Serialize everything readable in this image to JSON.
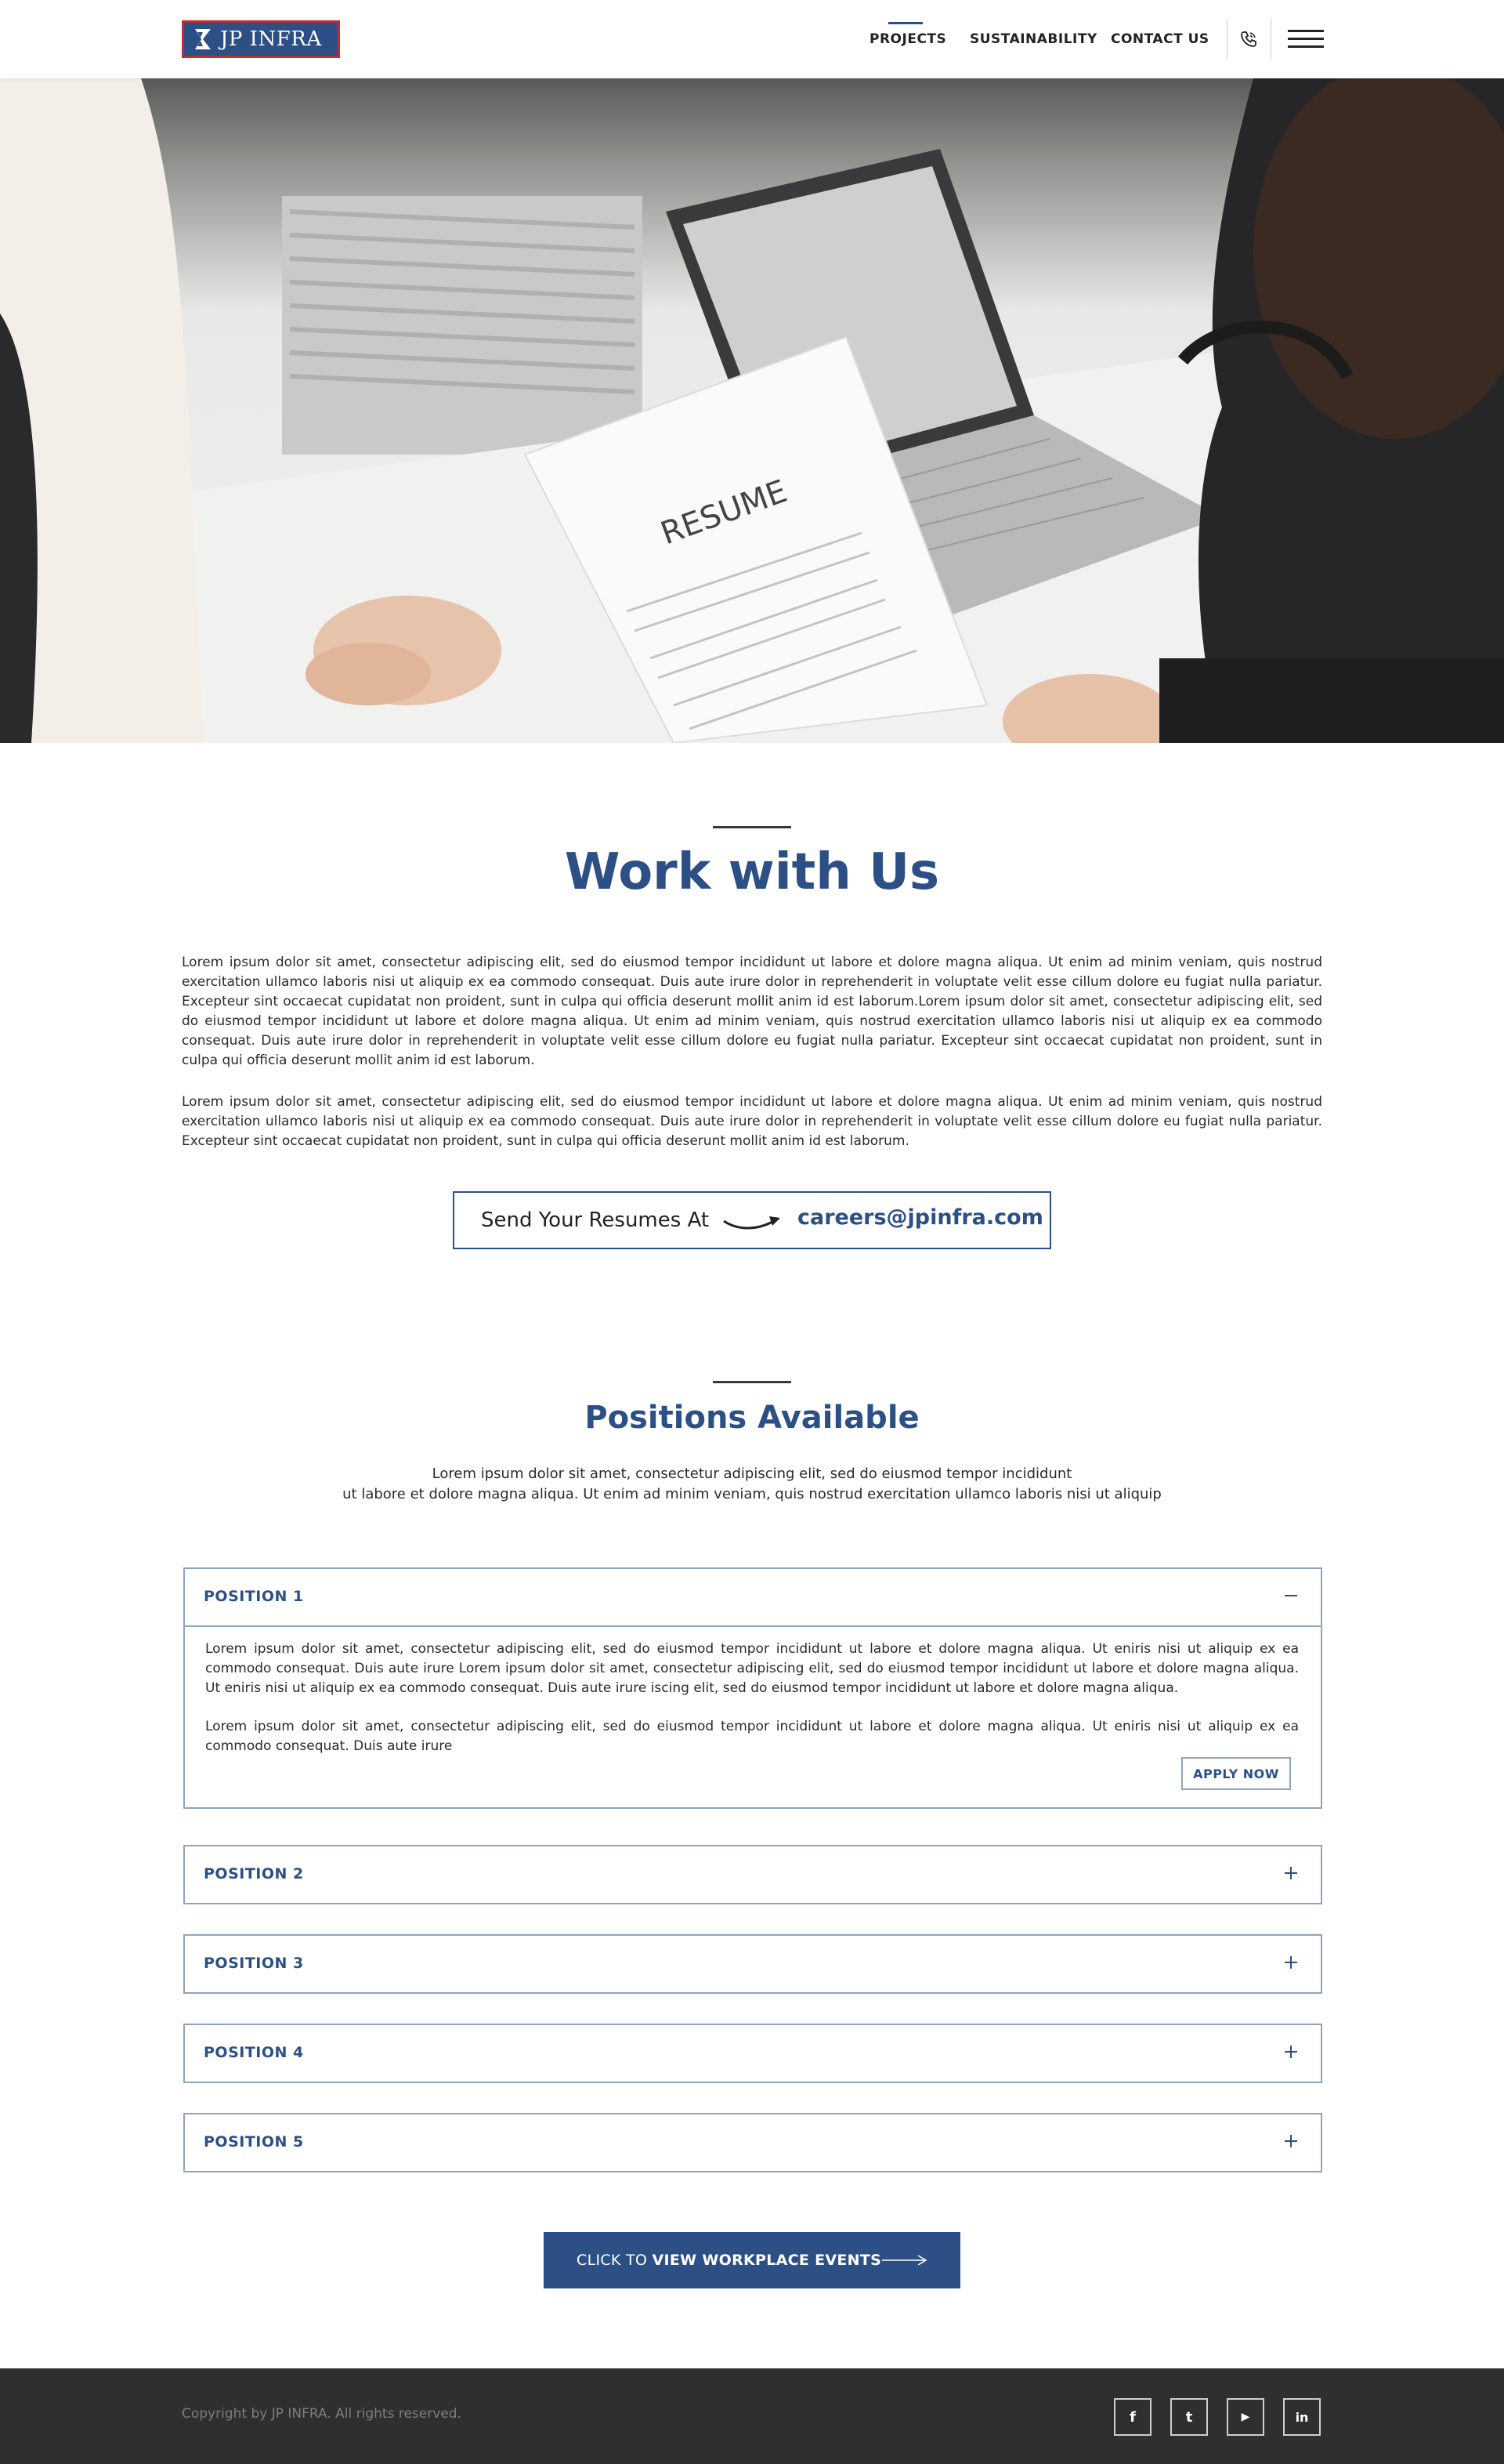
{
  "header": {
    "logo_text": "JP INFRA",
    "nav": [
      {
        "label": "PROJECTS"
      },
      {
        "label": "SUSTAINABILITY"
      },
      {
        "label": "CONTACT US"
      }
    ],
    "icons": {
      "phone": "phone-icon",
      "menu": "hamburger-menu-icon"
    }
  },
  "hero": {
    "image": "job interview with resume and laptop photo",
    "document_text": "RESUME"
  },
  "work": {
    "title": "Work with Us",
    "paragraph_1": "Lorem ipsum dolor sit amet, consectetur adipiscing elit, sed do eiusmod tempor incididunt ut labore et dolore magna aliqua. Ut enim ad minim veniam, quis nostrud exercitation ullamco laboris nisi ut aliquip ex ea commodo consequat. Duis aute irure dolor in reprehenderit in voluptate velit esse cillum dolore eu fugiat nulla pariatur. Excepteur sint occaecat cupidatat non proident, sunt in culpa qui officia deserunt mollit anim id est laborum.Lorem ipsum dolor sit amet, consectetur adipiscing elit, sed do eiusmod tempor incididunt ut labore et dolore magna aliqua. Ut enim ad minim veniam, quis nostrud exercitation ullamco laboris nisi ut aliquip ex ea commodo consequat. Duis aute irure dolor in reprehenderit in voluptate velit esse cillum dolore eu fugiat nulla pariatur. Excepteur sint occaecat cupidatat non proident, sunt in culpa qui officia deserunt mollit anim id est laborum.",
    "paragraph_2": "Lorem ipsum dolor sit amet, consectetur adipiscing elit, sed do eiusmod tempor incididunt ut labore et dolore magna aliqua. Ut enim ad minim veniam, quis nostrud exercitation ullamco laboris nisi ut aliquip ex ea commodo consequat. Duis aute irure dolor in reprehenderit in voluptate velit esse cillum dolore eu fugiat nulla pariatur. Excepteur sint occaecat cupidatat non proident, sunt in culpa qui officia deserunt mollit anim id est laborum.",
    "resume_label": "Send Your Resumes At",
    "resume_email": "careers@jpinfra.com"
  },
  "positions": {
    "title": "Positions Available",
    "intro_line_1": "Lorem ipsum dolor sit amet, consectetur adipiscing elit, sed do eiusmod tempor incididunt",
    "intro_line_2": "ut labore et dolore magna aliqua. Ut enim ad minim veniam, quis nostrud exercitation ullamco laboris nisi ut aliquip",
    "items": [
      {
        "label": "POSITION 1",
        "expanded": true,
        "body_1": "Lorem ipsum dolor sit amet, consectetur adipiscing elit, sed do eiusmod tempor incididunt ut labore et dolore magna aliqua. Ut eniris nisi ut aliquip ex ea commodo consequat. Duis aute irure Lorem ipsum dolor sit amet, consectetur adipiscing elit, sed do eiusmod tempor incididunt ut labore et dolore magna aliqua. Ut eniris nisi ut aliquip ex ea commodo consequat. Duis aute irure iscing elit, sed do eiusmod tempor incididunt ut labore et dolore magna aliqua.",
        "body_2": "Lorem ipsum dolor sit amet, consectetur adipiscing elit, sed do eiusmod tempor incididunt ut labore et dolore magna aliqua. Ut eniris nisi ut aliquip ex ea commodo consequat. Duis aute irure",
        "apply_label": "APPLY NOW"
      },
      {
        "label": "POSITION 2",
        "expanded": false
      },
      {
        "label": "POSITION 3",
        "expanded": false
      },
      {
        "label": "POSITION 4",
        "expanded": false
      },
      {
        "label": "POSITION 5",
        "expanded": false
      }
    ]
  },
  "cta": {
    "prefix": "CLICK TO ",
    "bold": "VIEW WORKPLACE EVENTS"
  },
  "footer": {
    "copyright": "Copyright by JP INFRA. All rights reserved.",
    "social": [
      {
        "icon": "facebook-icon",
        "glyph": "f"
      },
      {
        "icon": "twitter-icon",
        "glyph": "t"
      },
      {
        "icon": "youtube-icon",
        "glyph": "▶"
      },
      {
        "icon": "linkedin-icon",
        "glyph": "in"
      }
    ]
  },
  "colors": {
    "brand_blue": "#2c4f86",
    "logo_border_red": "#c9282d",
    "footer_bg": "#2f2f2f",
    "accordion_border": "#8ea3c4"
  }
}
